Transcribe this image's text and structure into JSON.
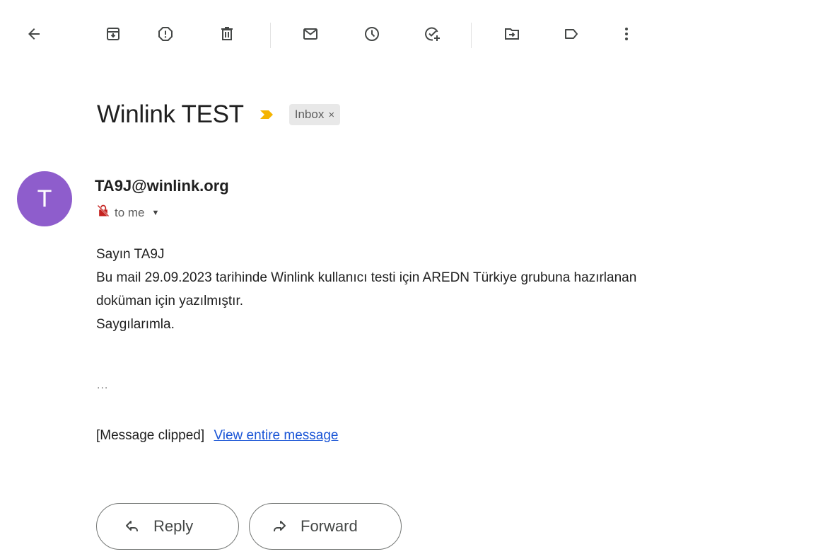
{
  "toolbar": {
    "icons": [
      "back-arrow-icon",
      "archive-icon",
      "report-spam-icon",
      "delete-icon",
      "mark-unread-icon",
      "snooze-icon",
      "add-to-tasks-icon",
      "move-to-icon",
      "label-icon",
      "more-vert-icon"
    ]
  },
  "email": {
    "subject": "Winlink TEST",
    "label": "Inbox",
    "label_remove": "×",
    "avatar_letter": "T",
    "sender": "TA9J@winlink.org",
    "recipient": "to me",
    "body_lines": [
      "Sayın TA9J",
      "Bu mail 29.09.2023 tarihinde Winlink kullanıcı testi için AREDN Türkiye grubuna hazırlanan",
      "doküman için yazılmıştır.",
      "Saygılarımla."
    ],
    "ellipsis": "...",
    "clipped_text": "[Message clipped]",
    "view_entire": "View entire message"
  },
  "actions": {
    "reply": "Reply",
    "forward": "Forward"
  },
  "colors": {
    "avatar": "#8e5dcc",
    "importance": "#f5b400",
    "link": "#1a55d6",
    "encryption_icon": "#c5221f"
  }
}
